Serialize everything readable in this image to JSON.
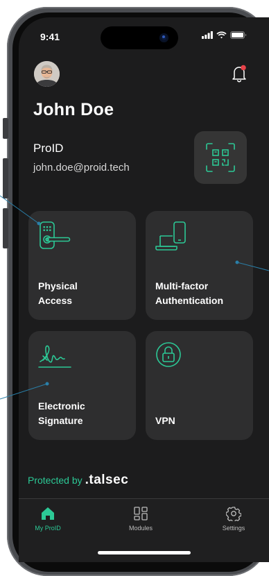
{
  "status_bar": {
    "time": "9:41"
  },
  "profile": {
    "name": "John Doe",
    "organization": "ProID",
    "email": "john.doe@proid.tech"
  },
  "tiles": [
    {
      "label_line1": "Physical",
      "label_line2": "Access",
      "icon": "door-lock-icon"
    },
    {
      "label_line1": "Multi-factor",
      "label_line2": "Authentication",
      "icon": "laptop-phone-icon"
    },
    {
      "label_line1": "Electronic",
      "label_line2": "Signature",
      "icon": "signature-icon"
    },
    {
      "label_line1": "",
      "label_line2": "VPN",
      "icon": "padlock-icon"
    }
  ],
  "footer": {
    "protected_by": "Protected by",
    "brand": ".talsec"
  },
  "tab_bar": {
    "items": [
      {
        "label": "My ProID",
        "icon": "home-icon",
        "active": true
      },
      {
        "label": "Modules",
        "icon": "modules-grid-icon",
        "active": false
      },
      {
        "label": "Settings",
        "icon": "gear-icon",
        "active": false
      }
    ]
  },
  "colors": {
    "accent": "#2cc996",
    "notification_dot": "#e8434a",
    "tile_bg": "#2e2e2f",
    "screen_bg": "#1c1c1d"
  }
}
